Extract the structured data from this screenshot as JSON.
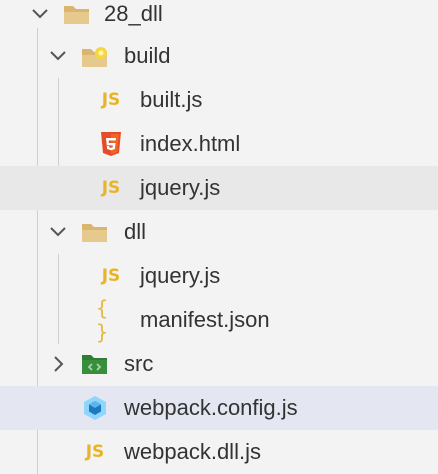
{
  "colors": {
    "folder": "#d9b570",
    "js": "#e8b42a",
    "html": "#e44d26",
    "webpack": "#8ed6fb",
    "src_folder": "#2e7d32"
  },
  "tree": {
    "root": {
      "label": "28_dll",
      "icon": "folder-open-icon",
      "expanded": true
    },
    "build": {
      "label": "build",
      "icon": "folder-build-icon",
      "expanded": true
    },
    "built_js": {
      "label": "built.js",
      "icon_text": "JS"
    },
    "index_html": {
      "label": "index.html",
      "icon": "html5-icon"
    },
    "build_jquery": {
      "label": "jquery.js",
      "icon_text": "JS"
    },
    "dll": {
      "label": "dll",
      "icon": "folder-open-icon",
      "expanded": true
    },
    "dll_jquery": {
      "label": "jquery.js",
      "icon_text": "JS"
    },
    "manifest": {
      "label": "manifest.json",
      "icon_text": "{ }"
    },
    "src": {
      "label": "src",
      "icon": "folder-src-icon",
      "expanded": false
    },
    "webpack_config": {
      "label": "webpack.config.js",
      "icon": "webpack-icon"
    },
    "webpack_dll": {
      "label": "webpack.dll.js",
      "icon_text": "JS"
    }
  }
}
